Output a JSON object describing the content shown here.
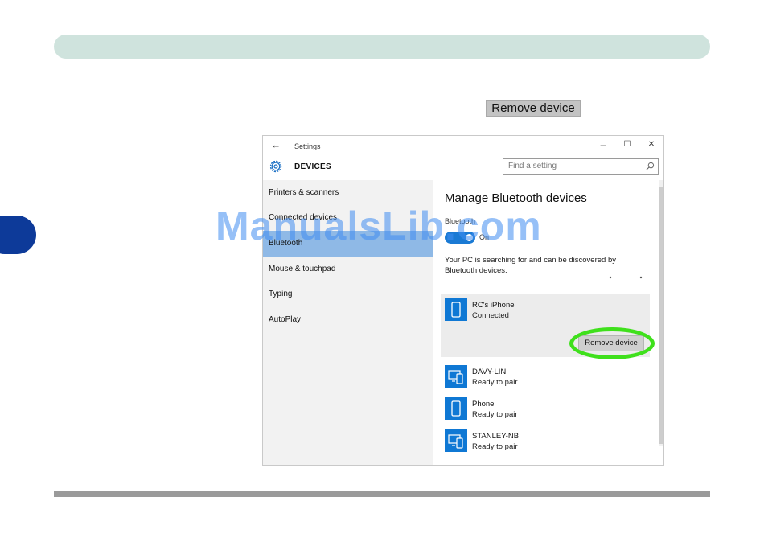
{
  "reference": {
    "remove_label": "Remove device"
  },
  "window": {
    "title": "Settings",
    "back_glyph": "←",
    "minimize_glyph": "–",
    "maximize_glyph": "☐",
    "close_glyph": "✕",
    "section_label": "DEVICES",
    "search_placeholder": "Find a setting"
  },
  "nav": {
    "items": [
      {
        "label": "Printers & scanners",
        "selected": false
      },
      {
        "label": "Connected devices",
        "selected": false
      },
      {
        "label": "Bluetooth",
        "selected": true
      },
      {
        "label": "Mouse & touchpad",
        "selected": false
      },
      {
        "label": "Typing",
        "selected": false
      },
      {
        "label": "AutoPlay",
        "selected": false
      }
    ]
  },
  "content": {
    "heading": "Manage Bluetooth devices",
    "bluetooth_label": "Bluetooth",
    "toggle_state": "On",
    "description": "Your PC is searching for and can be discovered by Bluetooth devices.",
    "devices": [
      {
        "name": "RC's iPhone",
        "status": "Connected",
        "icon": "phone-icon",
        "expanded": true,
        "action_label": "Remove device"
      },
      {
        "name": "DAVY-LIN",
        "status": "Ready to pair",
        "icon": "computer-phone-icon"
      },
      {
        "name": "Phone",
        "status": "Ready to pair",
        "icon": "phone-icon"
      },
      {
        "name": "STANLEY-NB",
        "status": "Ready to pair",
        "icon": "computer-phone-icon"
      }
    ]
  },
  "watermark": "ManualsLib.com",
  "colors": {
    "accent": "#0f78d4",
    "nav_selected": "#8fb9e6",
    "highlight_ring": "#3fe01c",
    "top_bar": "#cfe3dd",
    "side_tab": "#0d3a99"
  }
}
